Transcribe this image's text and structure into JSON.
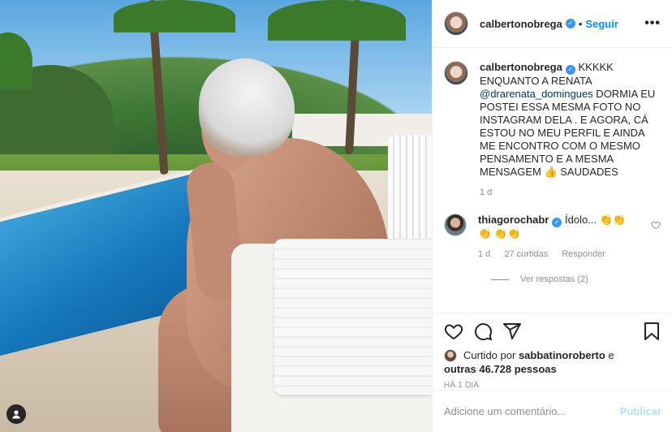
{
  "post": {
    "username": "calbertonobrega",
    "follow_label": "Seguir",
    "dot": "•",
    "more": "•••"
  },
  "caption": {
    "username": "calbertonobrega",
    "text_before": "KKKKK ENQUANTO A RENATA ",
    "mention": "@drarenata_domingues",
    "text_after": " DORMIA EU POSTEI ESSA MESMA FOTO NO INSTAGRAM DELA . E AGORA, CÁ ESTOU NO MEU PERFIL E AINDA ME ENCONTRO COM O MESMO PENSAMENTO E A MESMA MENSAGEM 👍 SAUDADES",
    "time": "1 d"
  },
  "comment": {
    "username": "thiagorochabr",
    "text": "Ídolo... 👏👏👏 👏👏",
    "time": "1 d",
    "likes": "27 curtidas",
    "reply": "Responder",
    "view_replies": "Ver respostas (2)"
  },
  "likes": {
    "prefix": "Curtido por",
    "user": "sabbatinoroberto",
    "conj": "e",
    "others": "outras 46.728 pessoas",
    "ago": "HÁ 1 DIA"
  },
  "add_comment": {
    "placeholder": "Adicione um comentário...",
    "publish": "Publicar"
  },
  "icons": [
    "heart-icon",
    "comment-icon",
    "share-icon",
    "bookmark-icon",
    "tag-user-icon",
    "verified-icon",
    "more-options-icon"
  ],
  "colors": {
    "link": "#0095f6",
    "muted": "#8e8e8e",
    "verified": "#3897f0",
    "publish_disabled": "#b2dffc"
  }
}
